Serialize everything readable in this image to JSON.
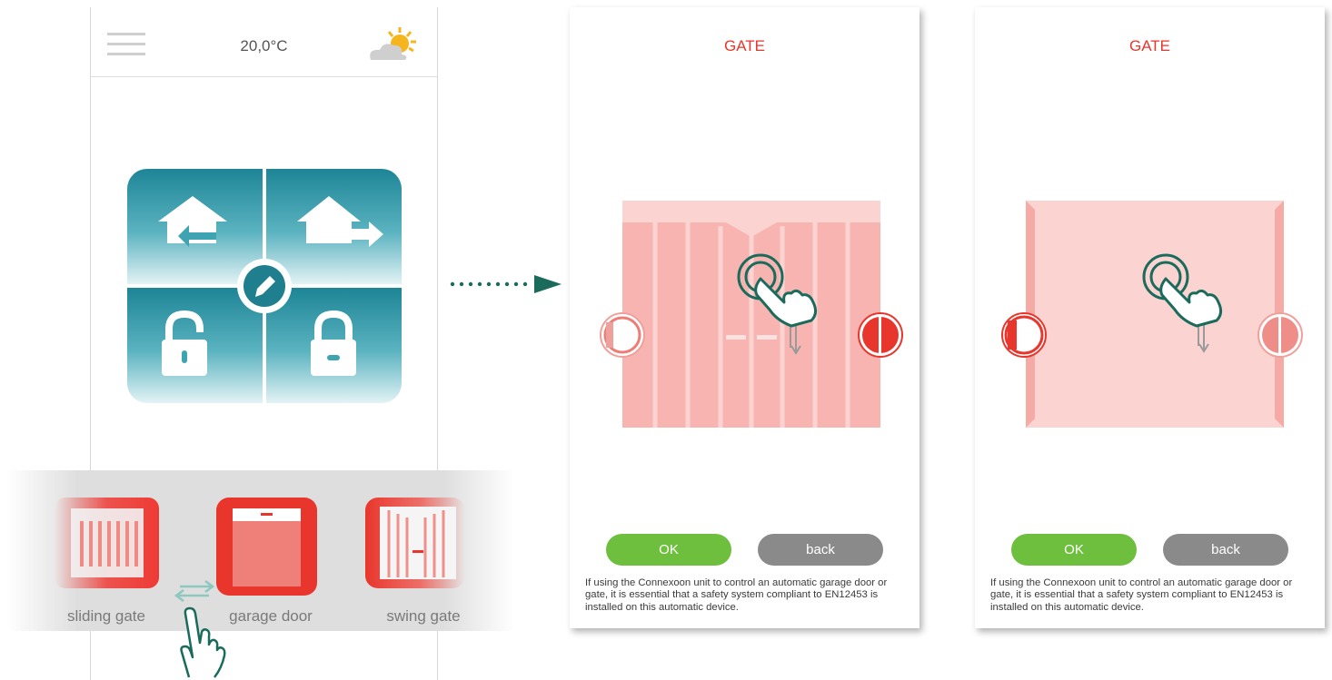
{
  "home": {
    "temperature": "20,0°C",
    "menu_icon": "hamburger-menu-icon",
    "weather_icon": "sun-cloud-icon",
    "tile_icons": [
      "house-arrow-in-icon",
      "house-arrow-out-icon",
      "padlock-open-icon",
      "padlock-closed-icon"
    ],
    "edit_icon": "pencil-icon"
  },
  "devices": [
    {
      "label": "sliding gate",
      "icon": "sliding-gate-icon"
    },
    {
      "label": "garage door",
      "icon": "garage-door-icon"
    },
    {
      "label": "swing gate",
      "icon": "swing-gate-icon"
    }
  ],
  "screens": [
    {
      "title": "GATE",
      "ok_label": "OK",
      "back_label": "back",
      "warning": "If using the Connexoon unit to control an automatic garage door or gate, it is essential that a safety system compliant to EN12453 is installed on this automatic device."
    },
    {
      "title": "GATE",
      "ok_label": "OK",
      "back_label": "back",
      "warning": "If using the Connexoon unit to control an automatic garage door or gate, it is essential that a safety system compliant to EN12453 is installed on this automatic device."
    }
  ],
  "colors": {
    "accent_red": "#e8362c",
    "ok_green": "#6fbf3f",
    "back_grey": "#8a8a8a",
    "teal": "#1e8b9c",
    "arrow_teal": "#1a6b5c"
  }
}
